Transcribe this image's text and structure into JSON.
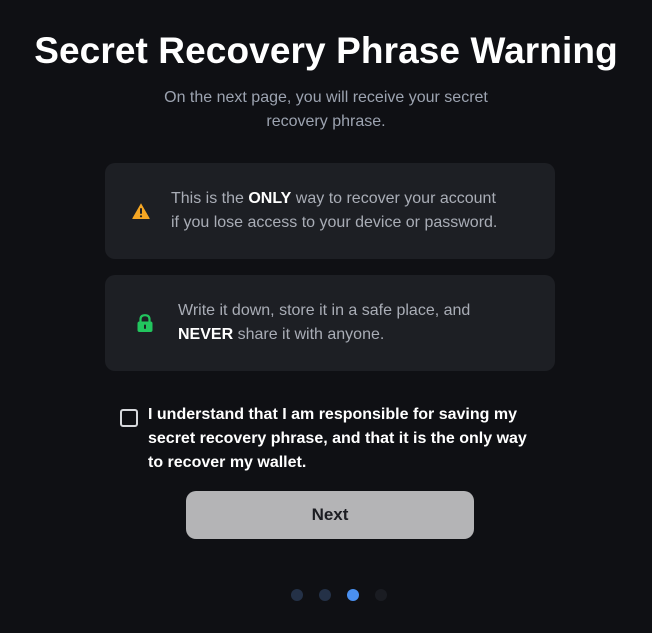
{
  "header": {
    "title": "Secret Recovery Phrase Warning",
    "subtitle_line1": "On the next page, you will receive your secret",
    "subtitle_line2": "recovery phrase."
  },
  "cards": [
    {
      "icon": "warning-icon",
      "icon_color": "#f5a623",
      "line1_pre": "This is the ",
      "line1_strong": "ONLY",
      "line1_post": " way to recover your account",
      "line2": "if you lose access to your device or password."
    },
    {
      "icon": "lock-icon",
      "icon_color": "#22c55e",
      "line1": "Write it down, store it in a safe place, and",
      "line2_strong": "NEVER",
      "line2_post": " share it with anyone."
    }
  ],
  "consent": {
    "checked": false,
    "line1": "I understand that I am responsible for saving my",
    "line2": "secret recovery phrase, and that it is the only way",
    "line3": "to recover my wallet."
  },
  "next_button": {
    "label": "Next"
  },
  "pagination": {
    "total": 4,
    "current": 3,
    "colors": {
      "active": "#4a90f0",
      "visited": "#243147",
      "upcoming": "#1a1c22"
    }
  }
}
